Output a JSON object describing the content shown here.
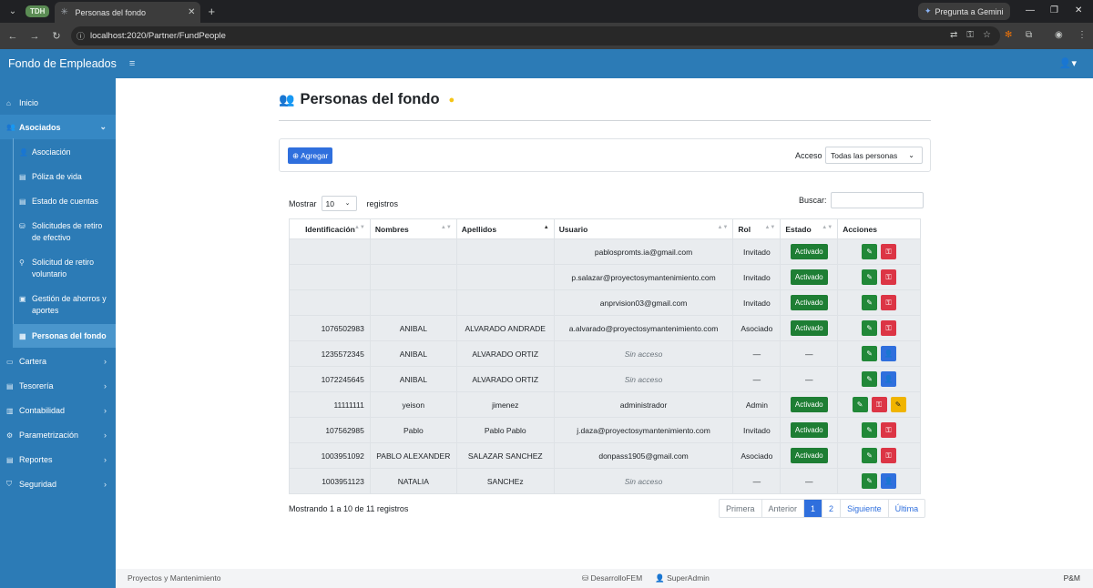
{
  "browser": {
    "tab_group": "TDH",
    "tab_title": "Personas del fondo",
    "url": "localhost:2020/Partner/FundPeople",
    "gemini_label": "Pregunta a Gemini"
  },
  "app": {
    "brand": "Fondo de Empleados"
  },
  "sidebar": {
    "items": [
      {
        "label": "Inicio",
        "icon": "home-icon"
      },
      {
        "label": "Asociados",
        "icon": "users-icon"
      },
      {
        "label": "Cartera",
        "icon": "folder-icon"
      },
      {
        "label": "Tesorería",
        "icon": "safe-icon"
      },
      {
        "label": "Contabilidad",
        "icon": "ledger-icon"
      },
      {
        "label": "Parametrización",
        "icon": "gear-icon"
      },
      {
        "label": "Reportes",
        "icon": "report-icon"
      },
      {
        "label": "Seguridad",
        "icon": "shield-icon"
      }
    ],
    "sub_items": [
      {
        "label": "Asociación"
      },
      {
        "label": "Póliza de vida"
      },
      {
        "label": "Estado de cuentas"
      },
      {
        "label": "Solicitudes de retiro de efectivo"
      },
      {
        "label": "Solicitud de retiro voluntario"
      },
      {
        "label": "Gestión de ahorros y aportes"
      },
      {
        "label": "Personas del fondo"
      }
    ]
  },
  "page": {
    "title": "Personas del fondo",
    "add_label": "Agregar",
    "acceso_label": "Acceso",
    "acceso_value": "Todas las personas",
    "mostrar_label": "Mostrar",
    "mostrar_value": "10",
    "registros_label": "registros",
    "buscar_label": "Buscar:",
    "info": "Mostrando 1 a 10 de 11 registros"
  },
  "table": {
    "headers": [
      "Identificación",
      "Nombres",
      "Apellidos",
      "Usuario",
      "Rol",
      "Estado",
      "Acciones"
    ],
    "rows": [
      {
        "id": "",
        "nombres": "",
        "apellidos": "",
        "usuario": "pablospromts.ia@gmail.com",
        "rol": "Invitado",
        "estado": "Activado",
        "actions": [
          "edit",
          "key"
        ]
      },
      {
        "id": "",
        "nombres": "",
        "apellidos": "",
        "usuario": "p.salazar@proyectosymantenimiento.com",
        "rol": "Invitado",
        "estado": "Activado",
        "actions": [
          "edit",
          "key"
        ]
      },
      {
        "id": "",
        "nombres": "",
        "apellidos": "",
        "usuario": "anprvision03@gmail.com",
        "rol": "Invitado",
        "estado": "Activado",
        "actions": [
          "edit",
          "key"
        ]
      },
      {
        "id": "1076502983",
        "nombres": "ANIBAL",
        "apellidos": "ALVARADO ANDRADE",
        "usuario": "a.alvarado@proyectosymantenimiento.com",
        "rol": "Asociado",
        "estado": "Activado",
        "actions": [
          "edit",
          "key"
        ]
      },
      {
        "id": "1235572345",
        "nombres": "ANIBAL",
        "apellidos": "ALVARADO ORTIZ",
        "usuario": "Sin acceso",
        "rol": "—",
        "estado": "—",
        "actions": [
          "edit",
          "user"
        ]
      },
      {
        "id": "1072245645",
        "nombres": "ANIBAL",
        "apellidos": "ALVARADO ORTIZ",
        "usuario": "Sin acceso",
        "rol": "—",
        "estado": "—",
        "actions": [
          "edit",
          "user"
        ]
      },
      {
        "id": "11111111",
        "nombres": "yeison",
        "apellidos": "jimenez",
        "usuario": "administrador",
        "rol": "Admin",
        "estado": "Activado",
        "actions": [
          "edit",
          "key",
          "warn"
        ]
      },
      {
        "id": "107562985",
        "nombres": "Pablo",
        "apellidos": "Pablo Pablo",
        "usuario": "j.daza@proyectosymantenimiento.com",
        "rol": "Invitado",
        "estado": "Activado",
        "actions": [
          "edit",
          "key"
        ]
      },
      {
        "id": "1003951092",
        "nombres": "PABLO ALEXANDER",
        "apellidos": "SALAZAR SANCHEZ",
        "usuario": "donpass1905@gmail.com",
        "rol": "Asociado",
        "estado": "Activado",
        "actions": [
          "edit",
          "key"
        ]
      },
      {
        "id": "1003951123",
        "nombres": "NATALIA",
        "apellidos": "SANCHEz",
        "usuario": "Sin acceso",
        "rol": "—",
        "estado": "—",
        "actions": [
          "edit",
          "user"
        ]
      }
    ]
  },
  "pager": {
    "first": "Primera",
    "prev": "Anterior",
    "pages": [
      "1",
      "2"
    ],
    "current": "1",
    "next": "Siguiente",
    "last": "Última"
  },
  "footer": {
    "left": "Proyectos y Mantenimiento",
    "db": "DesarrolloFEM",
    "user": "SuperAdmin",
    "right": "P&M"
  },
  "colors": {
    "primary": "#2c7bb6",
    "button_blue": "#2f6fdd",
    "success": "#1e7e34",
    "danger": "#dc3545",
    "warning": "#f0b400"
  }
}
